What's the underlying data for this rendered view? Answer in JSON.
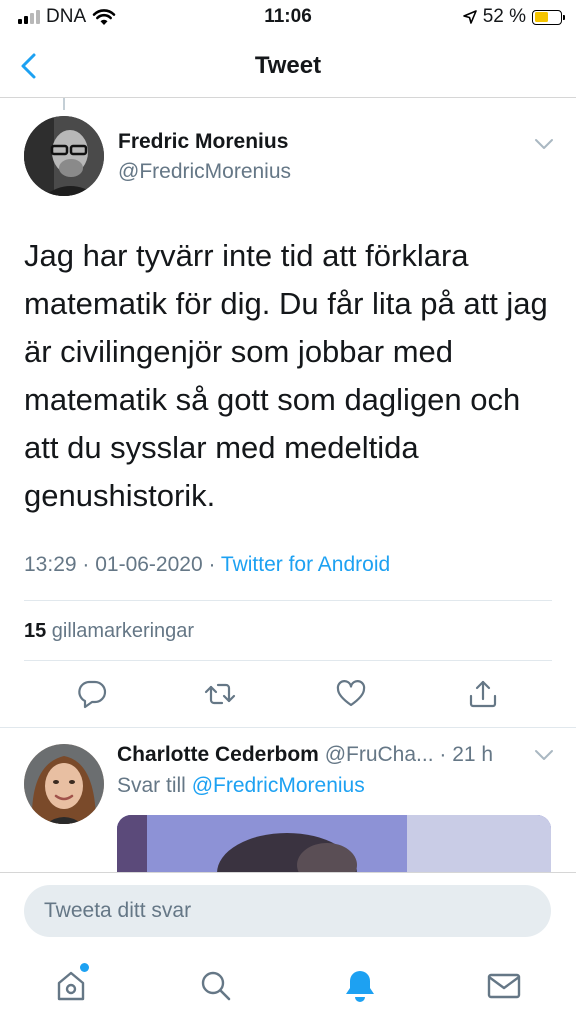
{
  "status_bar": {
    "carrier": "DNA",
    "time": "11:06",
    "battery": "52 %",
    "battery_level": 0.52
  },
  "header": {
    "title": "Tweet",
    "back_icon": "chevron-left-icon"
  },
  "tweet": {
    "author_name": "Fredric Morenius",
    "author_handle": "@FredricMorenius",
    "text": "Jag har tyvärr inte tid att förklara matematik för dig. Du får lita på att jag är civilingenjör som jobbar med matematik så gott som dagligen och att du sysslar med medeltida genushistorik.",
    "timestamp": "13:29 · 01-06-2020 · ",
    "source": "Twitter for Android",
    "like_count": "15",
    "like_label": " gillamarkeringar",
    "actions": [
      "reply-icon",
      "retweet-icon",
      "like-icon",
      "share-icon"
    ]
  },
  "reply": {
    "author_name": "Charlotte Cederbom",
    "meta": " @FruCha... · 21 h",
    "reply_to_label": "Svar till ",
    "reply_to_handle": "@FredricMorenius"
  },
  "compose": {
    "placeholder": "Tweeta ditt svar"
  },
  "tabbar": {
    "items": [
      "home-icon",
      "search-icon",
      "notifications-icon",
      "messages-icon"
    ]
  },
  "colors": {
    "accent": "#1da1f2",
    "secondary_text": "#657786",
    "primary_text": "#14171a"
  }
}
